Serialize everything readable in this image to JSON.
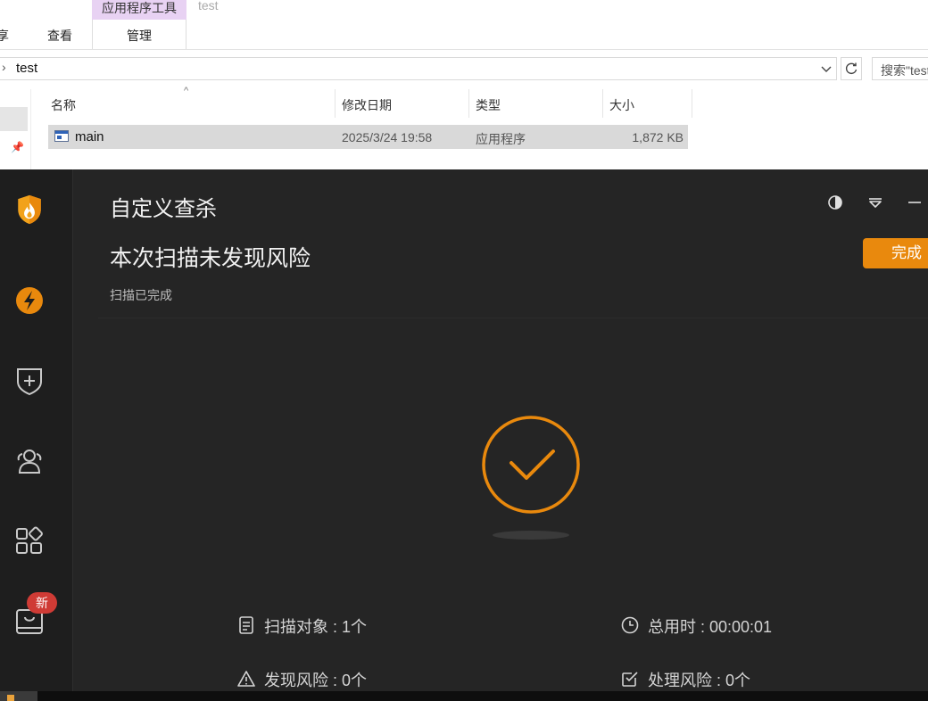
{
  "explorer": {
    "ribbon_tabs": [
      "享",
      "查看"
    ],
    "context_group": "应用程序工具",
    "context_tab": "管理",
    "context_title": "test",
    "address": "test",
    "search_placeholder": "搜索\"test\"",
    "columns": [
      "名称",
      "修改日期",
      "类型",
      "大小"
    ],
    "rows": [
      {
        "name": "main",
        "date": "2025/3/24 19:58",
        "type": "应用程序",
        "size": "1,872 KB"
      }
    ]
  },
  "app": {
    "title": "自定义查杀",
    "result_title": "本次扫描未发现风险",
    "result_sub": "扫描已完成",
    "done_button": "完成",
    "badge": "新",
    "stats": {
      "scan_objects": "扫描对象 : 1个",
      "total_time": "总用时 : 00:00:01",
      "risks_found": "发现风险 : 0个",
      "risks_handled": "处理风险 : 0个"
    },
    "accent_color": "#e9890d",
    "sidebar_icons": [
      "shield-flame-logo-icon",
      "lightning-icon",
      "shield-plus-icon",
      "users-icon",
      "apps-grid-icon",
      "toolbox-icon"
    ]
  }
}
